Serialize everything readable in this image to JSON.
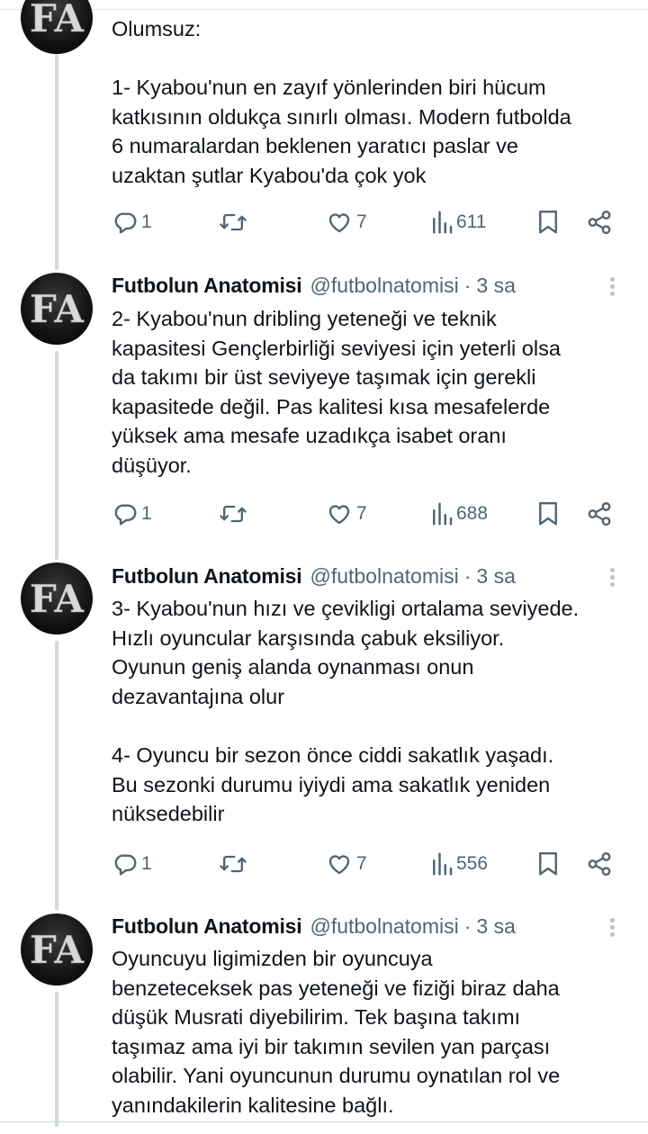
{
  "tweets": [
    {
      "show_header": false,
      "author": "",
      "handle": "",
      "time": "",
      "paragraphs": [
        [
          "Olumsuz:"
        ],
        [
          "1- Kyabou'nun en zayıf yönlerinden biri hücum",
          "katkısının oldukça sınırlı olması. Modern futbolda",
          "6 numaralardan beklenen yaratıcı paslar ve",
          "uzaktan şutlar Kyabou'da çok yok"
        ]
      ],
      "replies": "1",
      "likes": "7",
      "views": "611"
    },
    {
      "show_header": true,
      "author": "Futbolun Anatomisi",
      "handle": "@futbolnatomisi",
      "time": "3 sa",
      "paragraphs": [
        [
          "2- Kyabou'nun dribling yeteneği ve teknik",
          "kapasitesi Gençlerbirliği seviyesi için yeterli olsa",
          "da takımı bir üst seviyeye taşımak için gerekli",
          "kapasitede değil. Pas kalitesi kısa mesafelerde",
          "yüksek ama mesafe uzadıkça isabet oranı",
          "düşüyor."
        ]
      ],
      "replies": "1",
      "likes": "7",
      "views": "688"
    },
    {
      "show_header": true,
      "author": "Futbolun Anatomisi",
      "handle": "@futbolnatomisi",
      "time": "3 sa",
      "paragraphs": [
        [
          "3- Kyabou'nun hızı ve çevikligi ortalama seviyede.",
          "Hızlı oyuncular karşısında çabuk eksiliyor.",
          "Oyunun geniş alanda oynanması onun",
          "dezavantajına olur"
        ],
        [
          "4- Oyuncu bir sezon önce ciddi sakatlık yaşadı.",
          "Bu sezonki durumu iyiydi ama sakatlık yeniden",
          "nüksedebilir"
        ]
      ],
      "replies": "1",
      "likes": "7",
      "views": "556"
    },
    {
      "show_header": true,
      "author": "Futbolun Anatomisi",
      "handle": "@futbolnatomisi",
      "time": "3 sa",
      "paragraphs": [
        [
          "Oyuncuyu ligimizden bir oyuncuya",
          "benzeteceksek pas yeteneği ve fiziği biraz daha",
          "düşük Musrati diyebilirim. Tek başına takımı",
          "taşımaz ama iyi bir takımın sevilen yan parçası",
          "olabilir. Yani oyuncunun durumu oynatılan rol ve",
          "yanındakilerin kalitesine bağlı."
        ]
      ],
      "replies": "",
      "likes": "",
      "views": ""
    }
  ],
  "avatar_text": "FA",
  "colors": {
    "text": "#0f1419",
    "muted": "#536471",
    "thread_line": "#cfd9de"
  }
}
